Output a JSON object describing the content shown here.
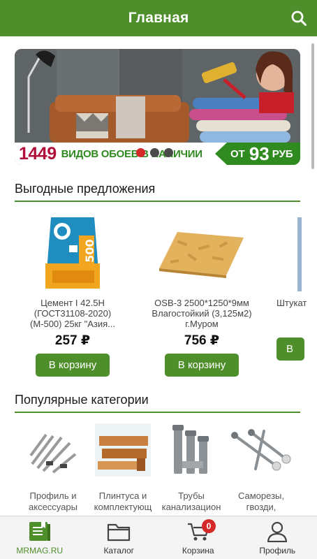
{
  "header": {
    "title": "Главная"
  },
  "banner": {
    "count": "1449",
    "text": "ВИДОВ ОБОЕВ В НАЛИЧИИ",
    "price_prefix": "ОТ",
    "price_value": "93",
    "price_currency": "РУБ",
    "slides_total": 3,
    "active_slide": 1,
    "colors": {
      "green": "#2f8a1f",
      "red": "#b0103a"
    }
  },
  "offers": {
    "title": "Выгодные предложения",
    "items": [
      {
        "name": "Цемент I 42.5Н (ГОСТ31108-2020) (М-500) 25кг \"Азия...",
        "price": "257 ₽",
        "button": "В корзину"
      },
      {
        "name": "OSB-3 2500*1250*9мм Влагостойкий (3,125м2) г.Муром",
        "price": "756 ₽",
        "button": "В корзину"
      },
      {
        "name": "Штукат",
        "price": "",
        "button": "В"
      }
    ]
  },
  "categories": {
    "title": "Популярные категории",
    "items": [
      {
        "name": "Профиль и аксессуары"
      },
      {
        "name": "Плинтуса и комплектующ"
      },
      {
        "name": "Трубы канализацион"
      },
      {
        "name": "Саморезы, гвозди,"
      }
    ]
  },
  "nav": {
    "items": [
      {
        "label": "MRMAG.RU",
        "icon": "home-book-icon",
        "active": true
      },
      {
        "label": "Каталог",
        "icon": "folder-icon"
      },
      {
        "label": "Корзина",
        "icon": "cart-icon",
        "badge": "0"
      },
      {
        "label": "Профиль",
        "icon": "user-icon"
      }
    ]
  },
  "theme": {
    "primary": "#4f8f2b",
    "badge": "#d62a2a"
  }
}
